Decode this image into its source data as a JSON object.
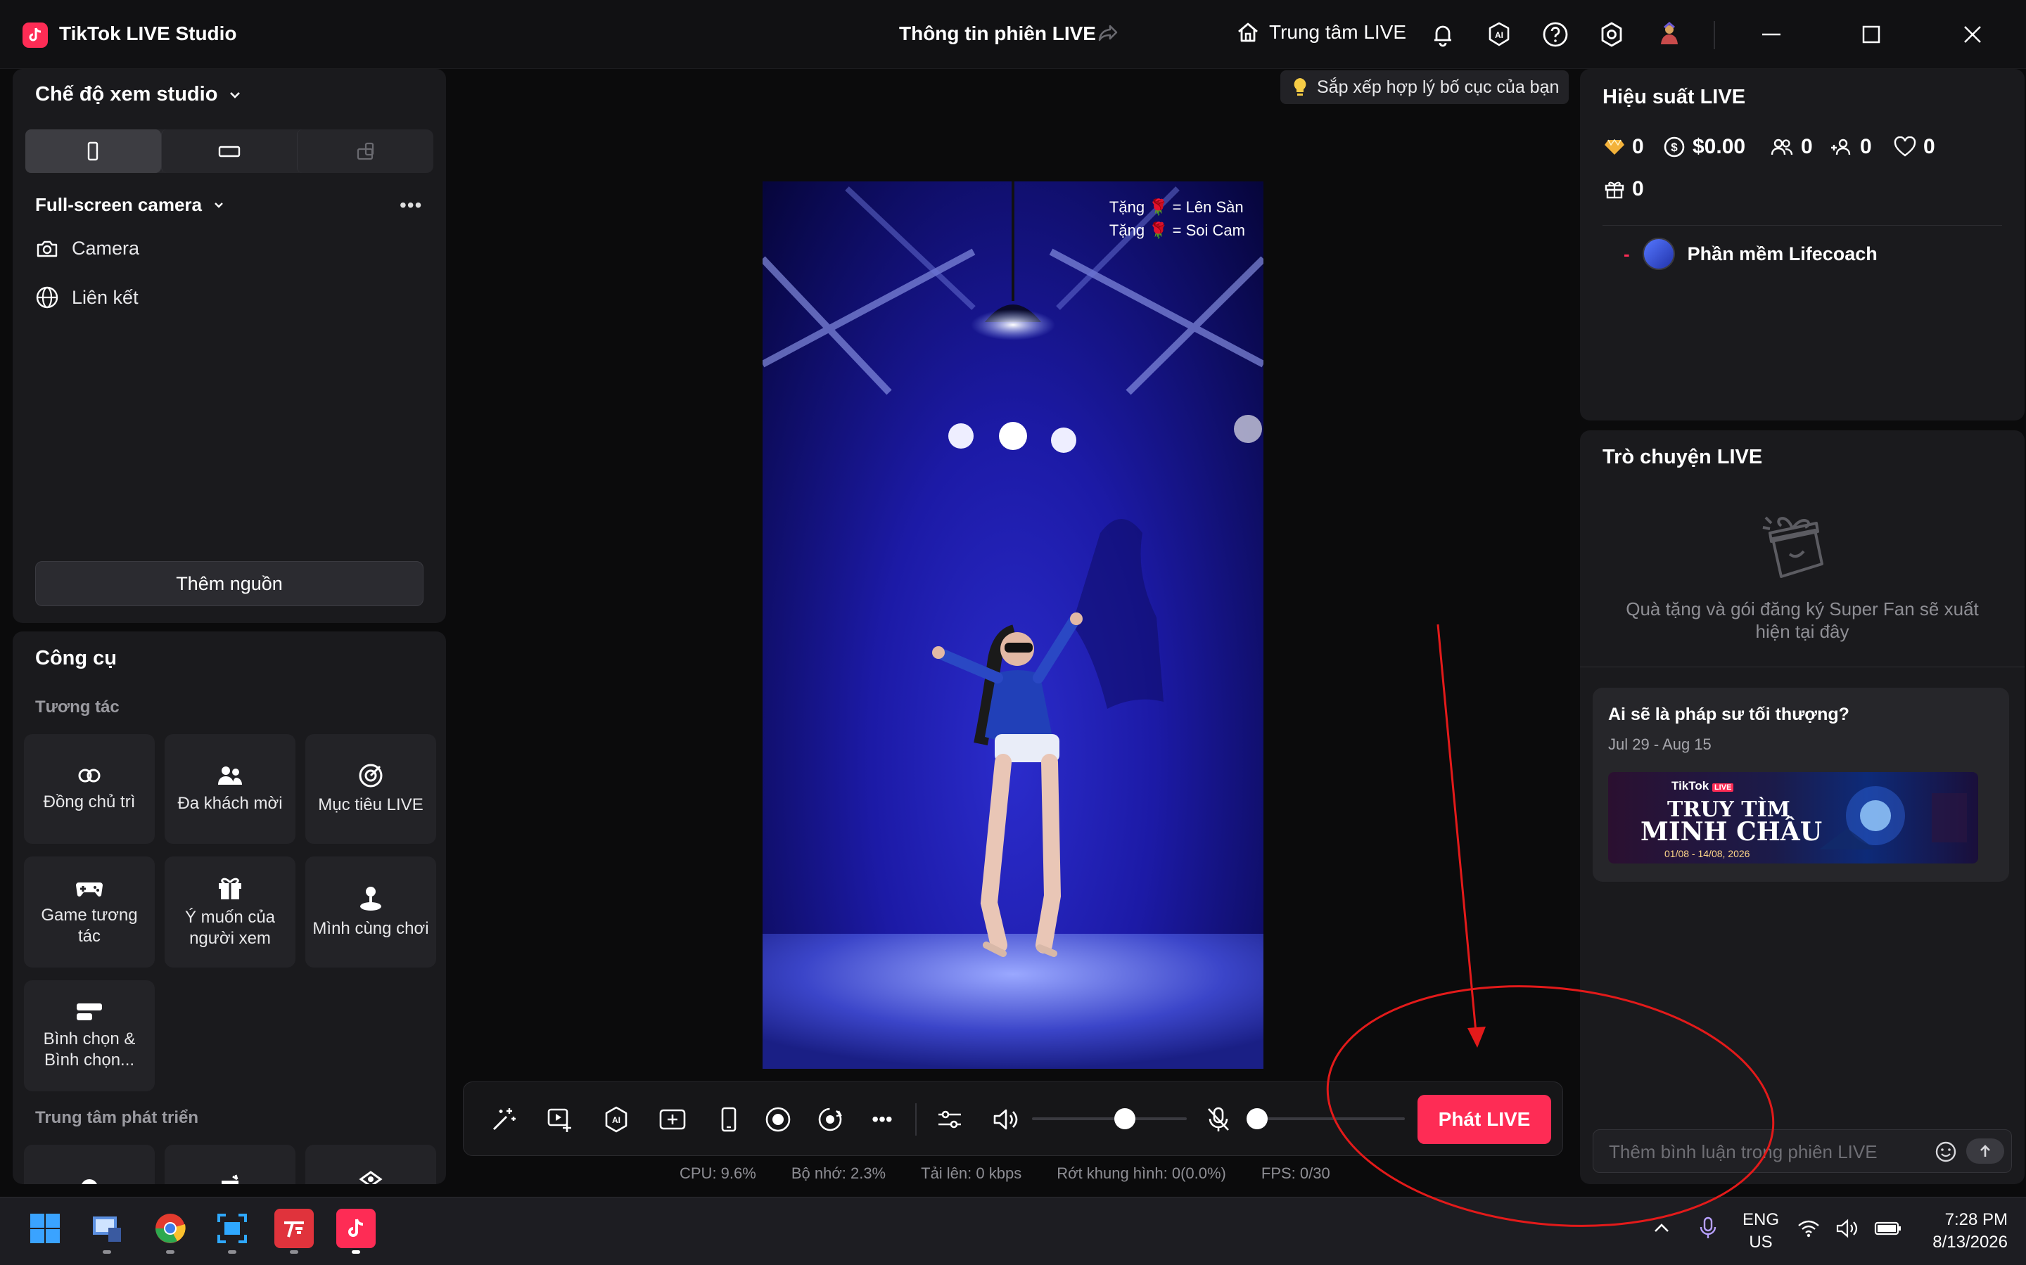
{
  "titlebar": {
    "app_title": "TikTok LIVE Studio",
    "session_title": "Thông tin phiên LIVE",
    "live_center_label": "Trung tâm LIVE",
    "ai_badge": "AI"
  },
  "left_panel": {
    "studio_mode_label": "Chế độ xem studio",
    "scene_name": "Full-screen camera",
    "sources": [
      {
        "label": "Camera",
        "icon": "camera-icon"
      },
      {
        "label": "Liên kết",
        "icon": "globe-icon"
      }
    ],
    "add_source_label": "Thêm nguồn"
  },
  "tools_panel": {
    "title": "Công cụ",
    "section_interaction": "Tương tác",
    "tools": [
      {
        "label": "Đồng chủ trì",
        "icon": "co-host-icon"
      },
      {
        "label": "Đa khách mời",
        "icon": "multi-guest-icon"
      },
      {
        "label": "Mục tiêu LIVE",
        "icon": "live-goal-icon"
      },
      {
        "label": "Game tương tác",
        "icon": "gamepad-icon"
      },
      {
        "label": "Ý muốn của người xem",
        "icon": "gift-wish-icon"
      },
      {
        "label": "Mình cùng chơi",
        "icon": "play-together-icon"
      },
      {
        "label": "Bình chọn & Bình chọn...",
        "icon": "poll-icon"
      }
    ],
    "section_growth": "Trung tâm phát triển"
  },
  "preview": {
    "tip": "Sắp xếp hợp lý bố cục của bạn",
    "overlay_line1": "Tặng 🌹 = Lên Sàn",
    "overlay_line2": "Tặng 🌹 = Soi Cam"
  },
  "toolbar": {
    "go_live_label": "Phát LIVE",
    "volume_level": 0.6,
    "mic_level": 0.0
  },
  "stats": {
    "cpu": "CPU:  9.6%",
    "memory": "Bộ nhớ:  2.3%",
    "upload": "Tải lên:  0 kbps",
    "dropped_frames": "Rớt khung hình:  0(0.0%)",
    "fps": "FPS:  0/30"
  },
  "performance": {
    "title": "Hiệu suất LIVE",
    "diamonds": "0",
    "earnings": "$0.00",
    "viewers": "0",
    "new_followers": "0",
    "likes": "0",
    "gifts": "0",
    "guest_dash": "-",
    "guest_name": "Phần mềm Lifecoach"
  },
  "chat": {
    "title": "Trò chuyện LIVE",
    "empty_message": "Quà tặng và gói đăng ký Super Fan sẽ xuất hiện tại đây",
    "promo_title": "Ai sẽ là pháp sư tối thượng?",
    "promo_dates": "Jul 29 - Aug 15",
    "banner_brand": "TikTok",
    "banner_live_tag": "LIVE",
    "banner_line1": "TRUY TÌM",
    "banner_line2": "MINH CHÂU",
    "banner_dates": "01/08 - 14/08, 2026",
    "comment_placeholder": "Thêm bình luận trong phiên LIVE"
  },
  "taskbar": {
    "lang_line1": "ENG",
    "lang_line2": "US",
    "time": "7:28 PM",
    "date": "8/13/2026"
  },
  "colors": {
    "accent": "#fe2c55",
    "panel": "#1a1a1d",
    "background": "#0b0b0c",
    "annotation": "#e31a1a"
  }
}
